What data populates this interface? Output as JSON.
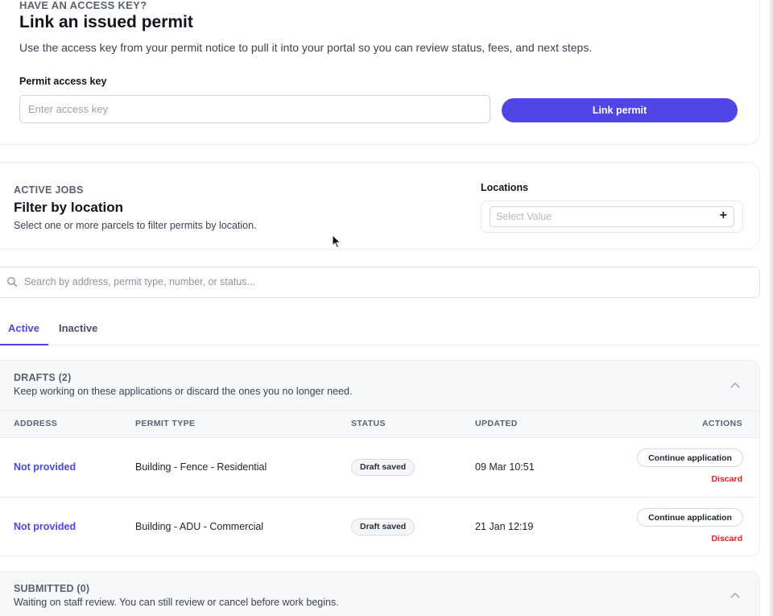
{
  "link_card": {
    "eyebrow": "HAVE AN ACCESS KEY?",
    "title": "Link an issued permit",
    "description": "Use the access key from your permit notice to pull it into your portal so you can review status, fees, and next steps.",
    "field_label": "Permit access key",
    "input_placeholder": "Enter access key",
    "input_value": "",
    "button_label": "Link permit"
  },
  "filter_card": {
    "eyebrow": "ACTIVE JOBS",
    "title": "Filter by location",
    "description": "Select one or more parcels to filter permits by location.",
    "locations_label": "Locations",
    "select_placeholder": "Select Value",
    "add_glyph": "+"
  },
  "search": {
    "placeholder": "Search by address, permit type, number, or status...",
    "value": ""
  },
  "tabs": [
    {
      "label": "Active",
      "selected": true
    },
    {
      "label": "Inactive",
      "selected": false
    }
  ],
  "drafts": {
    "title": "DRAFTS (2)",
    "subtitle": "Keep working on these applications or discard the ones you no longer need.",
    "columns": [
      "ADDRESS",
      "PERMIT TYPE",
      "STATUS",
      "UPDATED",
      "ACTIONS"
    ],
    "rows": [
      {
        "address": "Not provided",
        "permit_type": "Building - Fence - Residential",
        "status": "Draft saved",
        "updated": "09 Mar 10:51",
        "primary_action": "Continue application",
        "secondary_action": "Discard"
      },
      {
        "address": "Not provided",
        "permit_type": "Building - ADU - Commercial",
        "status": "Draft saved",
        "updated": "21 Jan 12:19",
        "primary_action": "Continue application",
        "secondary_action": "Discard"
      }
    ]
  },
  "submitted": {
    "title": "SUBMITTED (0)",
    "subtitle": "Waiting on staff review. You can still review or cancel before work begins."
  },
  "colors": {
    "accent": "#4f46e5",
    "danger": "#dc2626",
    "section_header_bg": "#f7f8fa"
  }
}
